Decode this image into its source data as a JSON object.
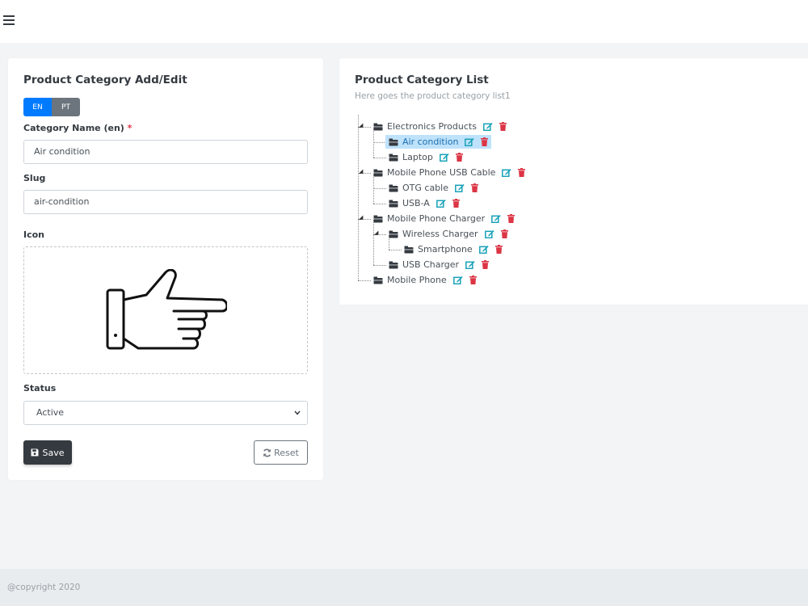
{
  "form": {
    "title": "Product Category Add/Edit",
    "lang_en": "EN",
    "lang_pt": "PT",
    "category_name_label": "Category Name (en)",
    "required_mark": "*",
    "category_name_value": "Air condition",
    "slug_label": "Slug",
    "slug_value": "air-condition",
    "icon_label": "Icon",
    "status_label": "Status",
    "status_value": "Active",
    "save_label": "Save",
    "reset_label": "Reset"
  },
  "list": {
    "title": "Product Category List",
    "subtitle": "Here goes the product category list1",
    "items": [
      {
        "label": "Electronics Products"
      },
      {
        "label": "Air condition"
      },
      {
        "label": "Laptop"
      },
      {
        "label": "Mobile Phone USB Cable"
      },
      {
        "label": "OTG cable"
      },
      {
        "label": "USB-A"
      },
      {
        "label": "Mobile Phone Charger"
      },
      {
        "label": "Wireless Charger"
      },
      {
        "label": "Smartphone"
      },
      {
        "label": "USB Charger"
      },
      {
        "label": "Mobile Phone"
      }
    ]
  },
  "footer": {
    "copyright": "@copyright 2020"
  },
  "colors": {
    "primary": "#007bff",
    "secondary": "#6c757d",
    "dark": "#343a40",
    "edit": "#17a2b8",
    "delete": "#dc3545",
    "selected_bg": "#bfe2fb"
  }
}
